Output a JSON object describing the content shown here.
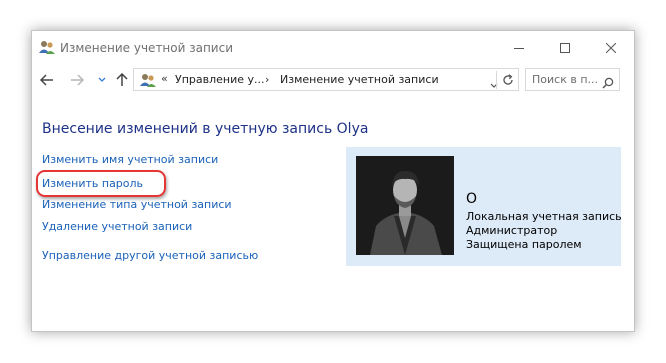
{
  "window": {
    "title": "Изменение учетной записи",
    "controls": {
      "minimize": "minimize-icon",
      "maximize": "maximize-icon",
      "close": "close-icon"
    }
  },
  "nav": {
    "address": {
      "overflow": "«",
      "crumbs": [
        "Управление у...",
        "Изменение учетной записи"
      ],
      "separator": "›"
    },
    "search_placeholder": "Поиск в п..."
  },
  "main": {
    "heading": "Внесение изменений в учетную запись Olya",
    "links": [
      "Изменить имя учетной записи",
      "Изменить пароль",
      "Изменение типа учетной записи",
      "Удаление учетной записи",
      "Управление другой учетной записью"
    ],
    "highlight_color": "#e53535"
  },
  "account": {
    "name": "O",
    "lines": [
      "Локальная учетная запись",
      "Администратор",
      "Защищена паролем"
    ],
    "panel_color": "#ddeaf7"
  },
  "colors": {
    "heading": "#1e3287",
    "link": "#1a61b8"
  }
}
